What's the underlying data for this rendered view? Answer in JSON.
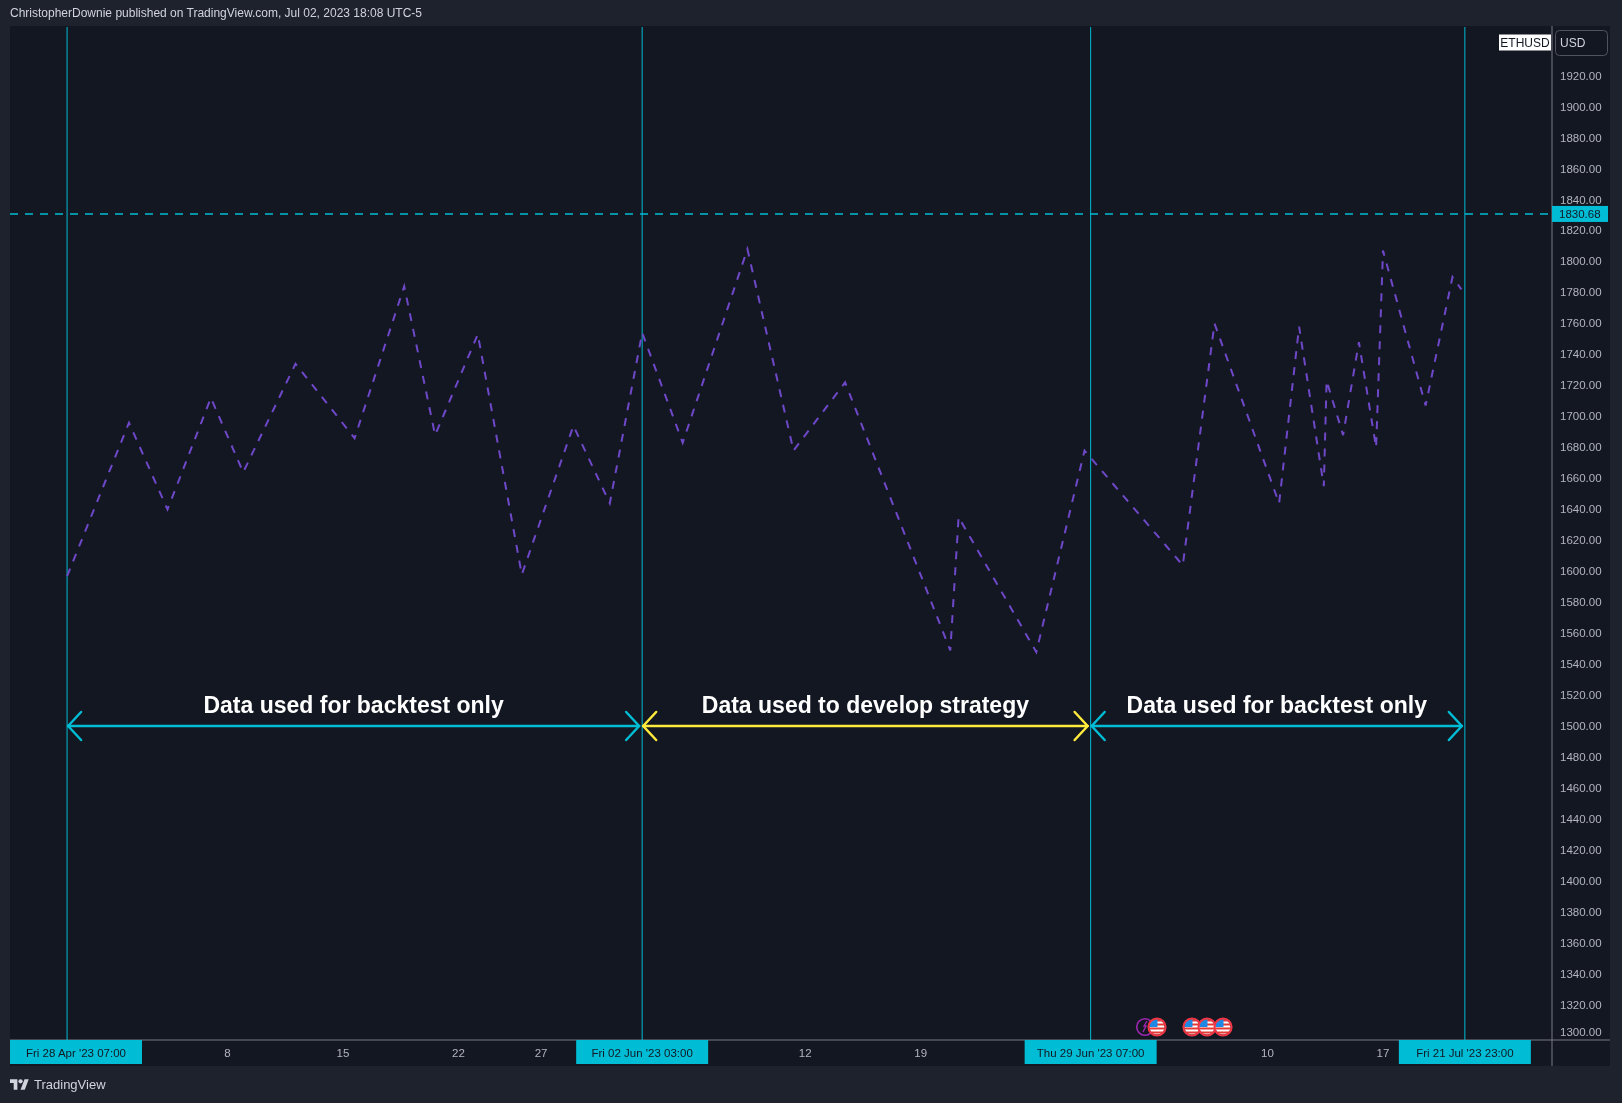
{
  "header": {
    "text": "ChristopherDownie published on TradingView.com, Jul 02, 2023 18:08 UTC-5"
  },
  "chart": {
    "symbol": "ETHUSD",
    "currency": "USD",
    "chart_data": {
      "type": "line",
      "line_style": "dashed",
      "x": [
        "2023-04-28T07:00",
        "2023-05-02T01:00",
        "2023-05-04T09:00",
        "2023-05-07T00:00",
        "2023-05-08T23:00",
        "2023-05-12T03:00",
        "2023-05-15T17:00",
        "2023-05-18T17:00",
        "2023-05-20T14:00",
        "2023-05-23T04:00",
        "2023-05-25T20:00",
        "2023-05-28T23:00",
        "2023-05-31T04:00",
        "2023-06-02T03:00",
        "2023-06-04T14:00",
        "2023-06-08T12:00",
        "2023-06-11T07:00",
        "2023-06-14T10:00",
        "2023-06-20T19:00",
        "2023-06-21T07:00",
        "2023-06-26T00:00",
        "2023-06-28T22:00",
        "2023-07-04T21:00",
        "2023-07-06T19:00",
        "2023-07-10T17:00",
        "2023-07-11T22:00",
        "2023-07-13T10:00",
        "2023-07-13T14:00",
        "2023-07-14T14:00",
        "2023-07-15T13:00",
        "2023-07-16T14:00",
        "2023-07-17T00:00",
        "2023-07-19T14:00",
        "2023-07-21T05:00",
        "2023-07-21T18:00"
      ],
      "values": [
        1597,
        1696,
        1640,
        1712,
        1664,
        1734,
        1686,
        1784,
        1688,
        1753,
        1598,
        1694,
        1644,
        1754,
        1683,
        1808,
        1678,
        1722,
        1549,
        1635,
        1548,
        1678,
        1604,
        1760,
        1644,
        1758,
        1655,
        1723,
        1688,
        1748,
        1680,
        1807,
        1707,
        1790,
        1782
      ],
      "xlim": [
        "2023-04-24T20:00",
        "2023-07-30T18:00"
      ],
      "ylim": [
        1297.7,
        1951.3
      ],
      "xticks": [
        {
          "value": "2023-05-08T00:00",
          "label": "8"
        },
        {
          "value": "2023-05-15T00:00",
          "label": "15"
        },
        {
          "value": "2023-05-22T00:00",
          "label": "22"
        },
        {
          "value": "2023-05-27T00:00",
          "label": "27"
        },
        {
          "value": "2023-06-12T00:00",
          "label": "12"
        },
        {
          "value": "2023-06-19T00:00",
          "label": "19"
        },
        {
          "value": "2023-07-10T00:00",
          "label": "10"
        },
        {
          "value": "2023-07-17T00:00",
          "label": "17"
        }
      ],
      "yticks": [
        {
          "value": 1920,
          "label": "1920.00"
        },
        {
          "value": 1900,
          "label": "1900.00"
        },
        {
          "value": 1880,
          "label": "1880.00"
        },
        {
          "value": 1860,
          "label": "1860.00"
        },
        {
          "value": 1840,
          "label": "1840.00"
        },
        {
          "value": 1820,
          "label": "1820.00"
        },
        {
          "value": 1800,
          "label": "1800.00"
        },
        {
          "value": 1780,
          "label": "1780.00"
        },
        {
          "value": 1760,
          "label": "1760.00"
        },
        {
          "value": 1740,
          "label": "1740.00"
        },
        {
          "value": 1720,
          "label": "1720.00"
        },
        {
          "value": 1700,
          "label": "1700.00"
        },
        {
          "value": 1680,
          "label": "1680.00"
        },
        {
          "value": 1660,
          "label": "1660.00"
        },
        {
          "value": 1640,
          "label": "1640.00"
        },
        {
          "value": 1620,
          "label": "1620.00"
        },
        {
          "value": 1600,
          "label": "1600.00"
        },
        {
          "value": 1580,
          "label": "1580.00"
        },
        {
          "value": 1560,
          "label": "1560.00"
        },
        {
          "value": 1540,
          "label": "1540.00"
        },
        {
          "value": 1520,
          "label": "1520.00"
        },
        {
          "value": 1500,
          "label": "1500.00"
        },
        {
          "value": 1480,
          "label": "1480.00"
        },
        {
          "value": 1460,
          "label": "1460.00"
        },
        {
          "value": 1440,
          "label": "1440.00"
        },
        {
          "value": 1420,
          "label": "1420.00"
        },
        {
          "value": 1400,
          "label": "1400.00"
        },
        {
          "value": 1380,
          "label": "1380.00"
        },
        {
          "value": 1360,
          "label": "1360.00"
        },
        {
          "value": 1340,
          "label": "1340.00"
        },
        {
          "value": 1320,
          "label": "1320.00"
        },
        {
          "value": 1300,
          "label": "1300.00"
        }
      ],
      "ref_lines": [
        {
          "axis": "y",
          "value": 1830.68,
          "label": "1830.68"
        },
        {
          "axis": "x",
          "value": "2023-04-28T07:00",
          "label": "Fri 28 Apr '23 07:00"
        },
        {
          "axis": "x",
          "value": "2023-06-02T03:00",
          "label": "Fri 02 Jun '23 03:00"
        },
        {
          "axis": "x",
          "value": "2023-06-29T07:00",
          "label": "Thu 29 Jun '23 07:00"
        },
        {
          "axis": "x",
          "value": "2023-07-21T23:00",
          "label": "Fri 21 Jul '23 23:00"
        }
      ]
    },
    "drawings": [
      {
        "label": "Data used for backtest only",
        "color": "#00bcd4"
      },
      {
        "label": "Data used to develop strategy",
        "color": "#ffeb3b"
      },
      {
        "label": "Data used for backtest only",
        "color": "#00bcd4"
      }
    ]
  },
  "footer": {
    "brand": "TradingView"
  }
}
